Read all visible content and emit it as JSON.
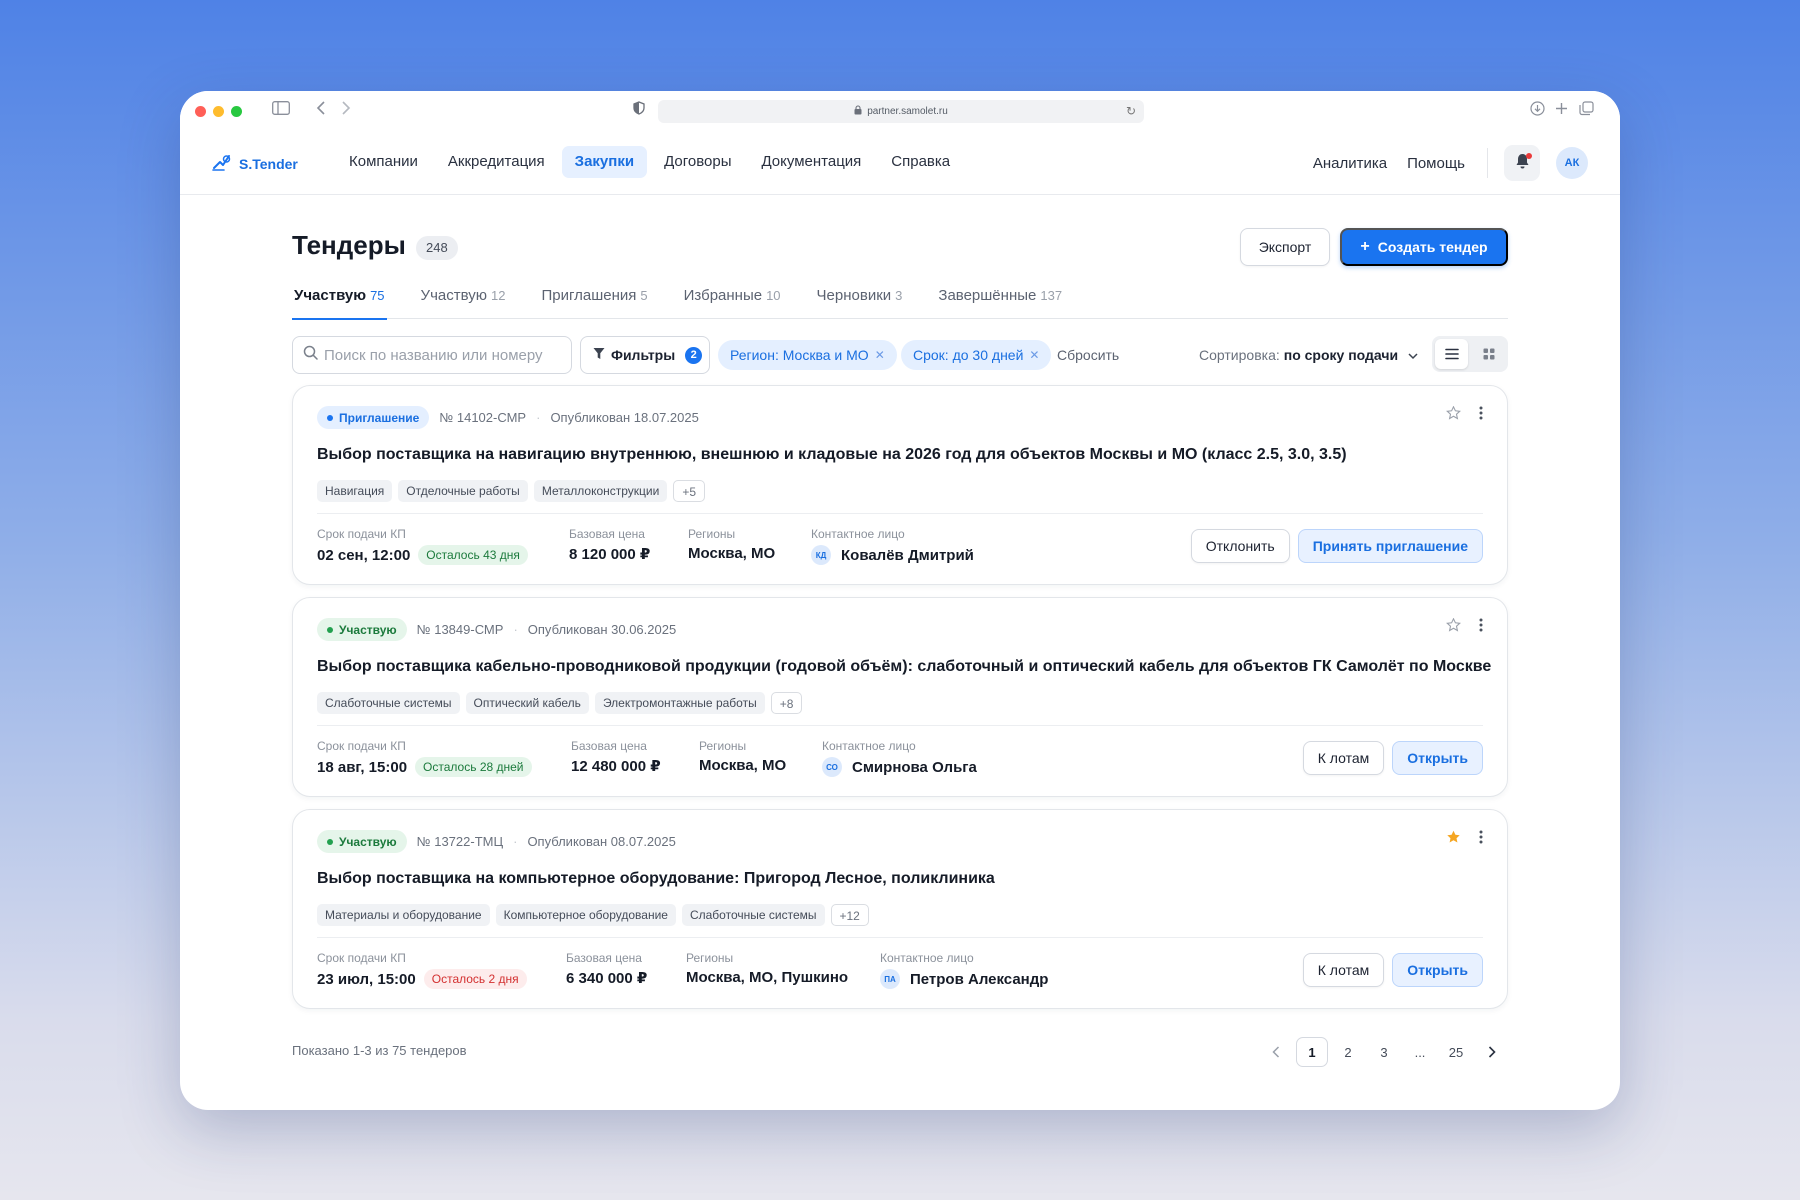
{
  "browser": {
    "url": "partner.samolet.ru"
  },
  "nav": {
    "logo": "S.Tender",
    "menu": [
      {
        "label": "Компании",
        "active": false
      },
      {
        "label": "Аккредитация",
        "active": false
      },
      {
        "label": "Закупки",
        "active": true
      },
      {
        "label": "Договоры",
        "active": false
      },
      {
        "label": "Документация",
        "active": false
      },
      {
        "label": "Справка",
        "active": false
      }
    ],
    "analytics": "Аналитика",
    "help": "Помощь",
    "avatar": "АК"
  },
  "page": {
    "title": "Тендеры",
    "count": "248",
    "export_label": "Экспорт",
    "create_label": "Создать тендер",
    "tabs": [
      {
        "label": "Участвую",
        "count": "75",
        "active": true
      },
      {
        "label": "Участвую",
        "count": "12",
        "active": false
      },
      {
        "label": "Приглашения",
        "count": "5",
        "active": false
      },
      {
        "label": "Избранные",
        "count": "10",
        "active": false
      },
      {
        "label": "Черновики",
        "count": "3",
        "active": false
      },
      {
        "label": "Завершённые",
        "count": "137",
        "active": false
      }
    ]
  },
  "toolbar": {
    "search_placeholder": "Поиск по названию или номеру",
    "filters_label": "Фильтры",
    "filters_count": "2",
    "chips": [
      "Регион: Москва и МО",
      "Срок: до 30 дней"
    ],
    "reset_label": "Сбросить",
    "sort_label": "Сортировка:",
    "sort_value": "по сроку подачи"
  },
  "labels": {
    "deadline": "Срок подачи КП",
    "price": "Базовая цена",
    "regions": "Регионы",
    "contact": "Контактное лицо"
  },
  "cards": [
    {
      "status": "Приглашение",
      "number": "№ 14102-СМР",
      "published": "Опубликован 18.07.2025",
      "title": "Выбор поставщика на навигацию внутреннюю, внешнюю и кладовые на 2026 год для объектов Москвы и МО (класс 2.5, 3.0, 3.5)",
      "tags": [
        "Навигация",
        "Отделочные работы",
        "Металлоконструкции"
      ],
      "more": "+5",
      "deadline": "02 сен, 12:00",
      "remaining": "Осталось 43 дня",
      "price": "8 120 000 ₽",
      "regions": "Москва, МО",
      "contact_initials": "КД",
      "contact": "Ковалёв Дмитрий",
      "btn_secondary": "Отклонить",
      "btn_primary": "Принять приглашение",
      "favorite": false
    },
    {
      "status": "Участвую",
      "number": "№ 13849-СМР",
      "published": "Опубликован 30.06.2025",
      "title": "Выбор поставщика кабельно-проводниковой продукции (годовой объём): слаботочный и оптический кабель для объектов ГК Самолёт по Москве",
      "tags": [
        "Слаботочные системы",
        "Оптический кабель",
        "Электромонтажные работы"
      ],
      "more": "+8",
      "deadline": "18 авг, 15:00",
      "remaining": "Осталось 28 дней",
      "price": "12 480 000 ₽",
      "regions": "Москва, МО",
      "contact_initials": "СО",
      "contact": "Смирнова Ольга",
      "btn_secondary": "К лотам",
      "btn_primary": "Открыть",
      "favorite": false
    },
    {
      "status": "Участвую",
      "number": "№ 13722-ТМЦ",
      "published": "Опубликован 08.07.2025",
      "title": "Выбор поставщика на компьютерное оборудование: Пригород Лесное, поликлиника",
      "tags": [
        "Материалы и оборудование",
        "Компьютерное оборудование",
        "Слаботочные системы"
      ],
      "more": "+12",
      "deadline": "23 июл, 15:00",
      "remaining": "Осталось 2 дня",
      "price": "6 340 000 ₽",
      "regions": "Москва, МО, Пушкино",
      "contact_initials": "ПА",
      "contact": "Петров Александр",
      "btn_secondary": "К лотам",
      "btn_primary": "Открыть",
      "favorite": true
    }
  ],
  "footer": {
    "showing": "Показано 1-3 из 75 тендеров",
    "pages": [
      "1",
      "2",
      "3",
      "...",
      "25"
    ]
  },
  "colors": {
    "accent": "#1a74f0",
    "star_active": "#f5a623",
    "success": "#1b7a3c",
    "danger": "#d33030"
  }
}
